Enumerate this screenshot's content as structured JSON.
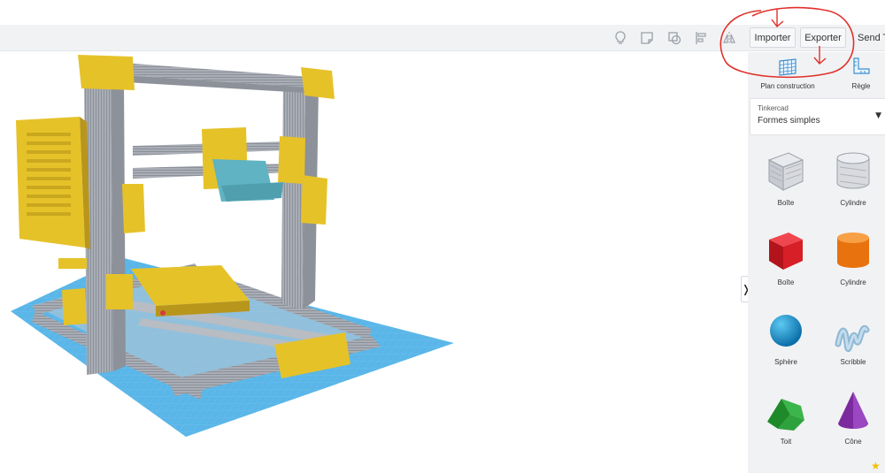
{
  "toolbar": {
    "icons": [
      "lightbulb-icon",
      "note-icon",
      "hide-icon",
      "align-icon",
      "mirror-icon"
    ],
    "import_label": "Importer",
    "export_label": "Exporter",
    "sendto_label": "Send To"
  },
  "panel": {
    "tools": [
      {
        "label": "Plan construction",
        "icon": "workplane-grid-icon"
      },
      {
        "label": "Règle",
        "icon": "ruler-icon"
      }
    ],
    "library": {
      "category": "Tinkercad",
      "selected": "Formes simples"
    },
    "shapes": [
      {
        "label": "Boîte",
        "icon": "box-hole-icon"
      },
      {
        "label": "Cylindre",
        "icon": "cylinder-hole-icon"
      },
      {
        "label": "Boîte",
        "icon": "box-red-icon"
      },
      {
        "label": "Cylindre",
        "icon": "cylinder-orange-icon"
      },
      {
        "label": "Sphère",
        "icon": "sphere-icon"
      },
      {
        "label": "Scribble",
        "icon": "scribble-icon"
      },
      {
        "label": "Toit",
        "icon": "roof-icon"
      },
      {
        "label": "Cône",
        "icon": "cone-icon"
      }
    ]
  },
  "colors": {
    "frame_yellow": "#e6c229",
    "rail_grey": "#a9adb5",
    "bed_blue": "#5ab6e8",
    "extruder_teal": "#5fb3c2",
    "annotation_red": "#e0312a"
  }
}
